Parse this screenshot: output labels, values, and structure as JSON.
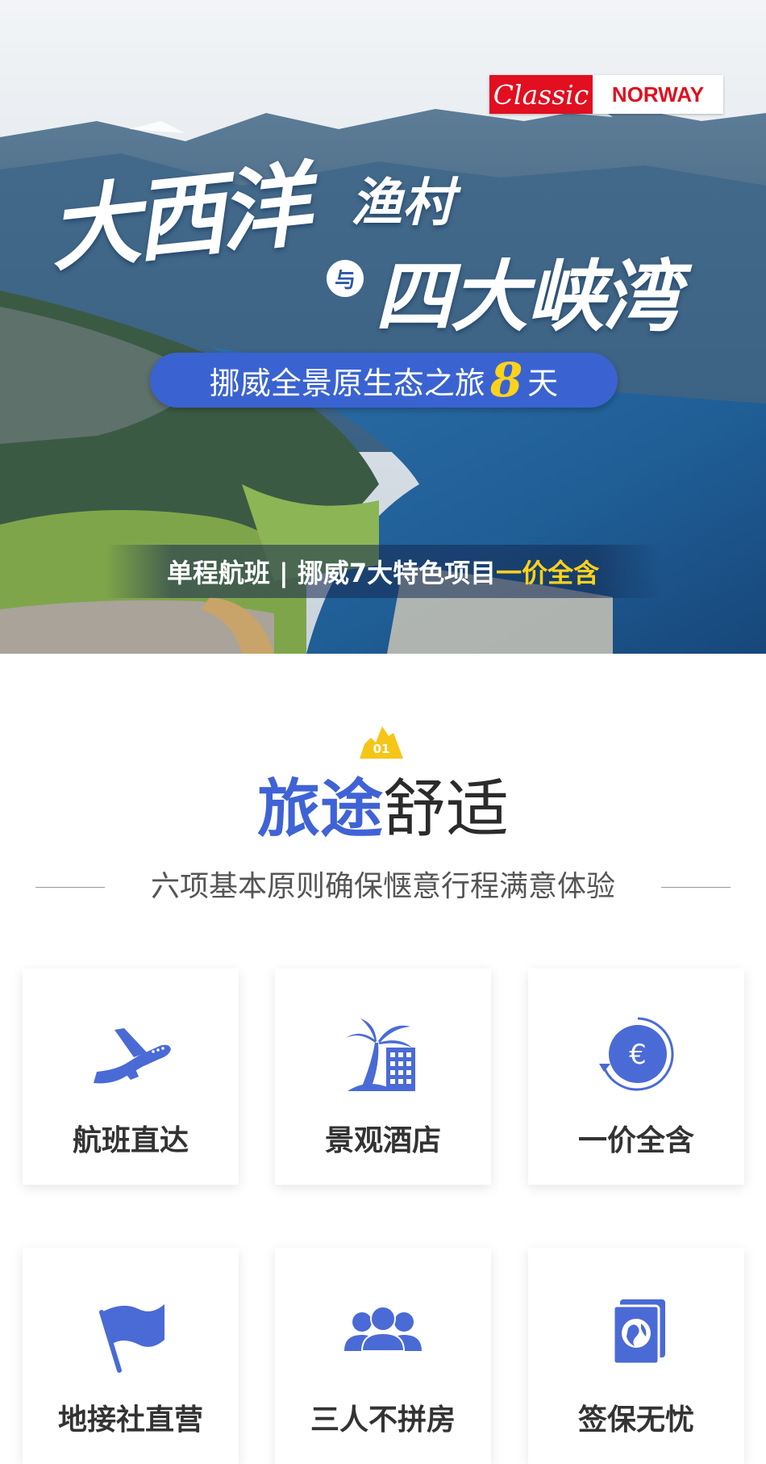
{
  "banner": {
    "badge_classic": "Classic",
    "badge_norway": "NORWAY",
    "title_main": "大西洋",
    "title_small": "渔村",
    "title_connector": "与",
    "title_big": "四大峡湾",
    "pill_prefix": "挪威全景原生态之旅",
    "pill_days": "8",
    "pill_suffix": "天",
    "strip_text": "单程航班 | 挪威7大特色项目",
    "strip_highlight": "一价全含"
  },
  "section": {
    "number": "01",
    "title_blue": "旅途",
    "title_dark": "舒适",
    "subtitle": "六项基本原则确保惬意行程满意体验"
  },
  "features": [
    {
      "label": "航班直达",
      "icon": "airplane-icon"
    },
    {
      "label": "景观酒店",
      "icon": "palm-hotel-icon"
    },
    {
      "label": "一价全含",
      "icon": "euro-coin-icon"
    },
    {
      "label": "地接社直营",
      "icon": "flag-icon"
    },
    {
      "label": "三人不拼房",
      "icon": "group-icon"
    },
    {
      "label": "签保无忧",
      "icon": "passport-icon"
    }
  ],
  "colors": {
    "accent_blue": "#3f63d6",
    "badge_red": "#e10f1f",
    "highlight_yellow": "#ffd21a",
    "number_badge_yellow": "#f5c518"
  }
}
